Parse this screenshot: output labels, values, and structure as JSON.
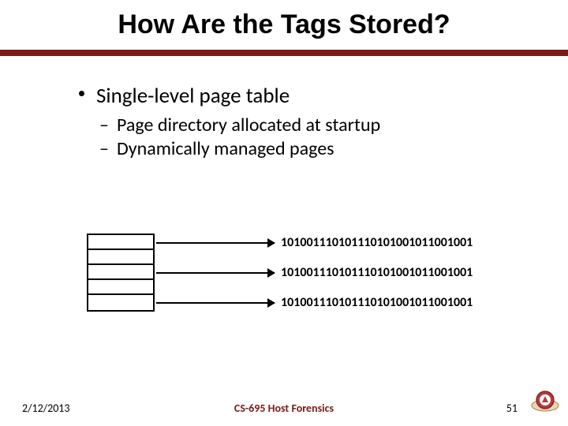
{
  "title": "How Are the Tags Stored?",
  "bullets": {
    "main": "Single-level page table",
    "sub1": "Page directory allocated at startup",
    "sub2": "Dynamically managed pages"
  },
  "diagram": {
    "bits1": "101001110101110101001011001001",
    "bits2": "101001110101110101001011001001",
    "bits3": "101001110101110101001011001001"
  },
  "footer": {
    "date": "2/12/2013",
    "course": "CS-695 Host Forensics",
    "page": "51"
  }
}
